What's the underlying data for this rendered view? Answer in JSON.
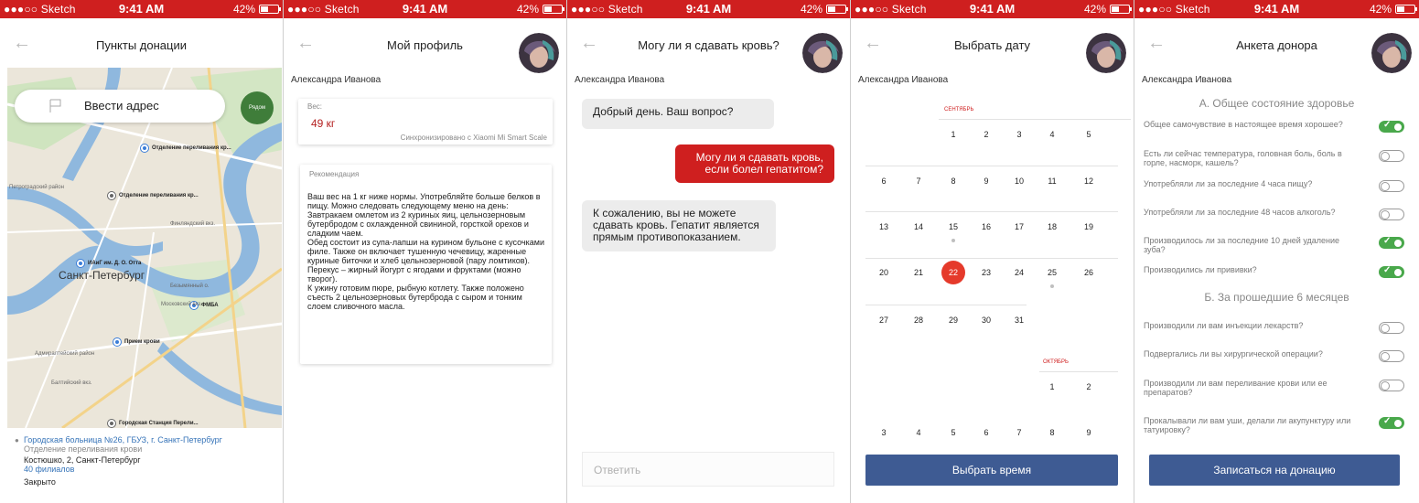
{
  "status": {
    "carrier": "●●●○○ Sketch",
    "time": "9:41 AM",
    "battery": "42%",
    "battery_level": 0.42
  },
  "screen1": {
    "title": "Пункты донации",
    "address_placeholder": "Ввести адрес",
    "near_button": "Рядом",
    "pins": [
      "Отделение переливания кр...",
      "Отделение переливания кр...",
      "ИАиГ им. Д. О. Отта",
      "ФМБА",
      "Прием крови",
      "Городская Станция Перели..."
    ],
    "map_labels": [
      "Петроградский район",
      "Финляндский вкз.",
      "Московский вкз.",
      "Безымянный о.",
      "Адмиралтейский район",
      "Балтийский вкз."
    ],
    "city": "Санкт-Петербург",
    "info": {
      "link": "Городская больница №26, ГБУЗ, г. Санкт-Петербург",
      "sub": "Отделение переливания крови",
      "address": "Костюшко, 2, Санкт-Петербург",
      "branches": "40 филиалов",
      "status": "Закрыто"
    }
  },
  "screen2": {
    "title": "Мой профиль",
    "username": "Александра Иванова",
    "weight_label": "Вес:",
    "weight_value": "49 кг",
    "sync": "Синхронизировано с Xiaomi Mi Smart Scale",
    "rec_label": "Рекомендация",
    "rec_body": "Ваш вес на 1 кг ниже нормы. Употребляйте больше белков в пищу. Можно следовать следующему меню на день:\nЗавтракаем омлетом из 2 куриных яиц, цельнозерновым бутербродом с охлажденной свининой, горсткой орехов и сладким чаем.\nОбед состоит из супа-лапши на курином бульоне с кусочками филе. Также он включает тушенную чечевицу, жаренные куриные биточки и хлеб цельнозерновой (пару ломтиков).\nПерекус – жирный йогурт с ягодами и фруктами (можно творог).\nК ужину готовим пюре, рыбную котлету. Также положено съесть 2 цельнозерновых бутерброда с сыром и тонким слоем сливочного масла."
  },
  "screen3": {
    "title": "Могу ли я сдавать кровь?",
    "username": "Александра Иванова",
    "messages": [
      {
        "side": "in",
        "text": "Добрый день. Ваш вопрос?"
      },
      {
        "side": "out",
        "text": "Могу ли я сдавать кровь, если болел гепатитом?"
      },
      {
        "side": "in",
        "text": "К сожалению, вы не можете сдавать кровь. Гепатит является прямым противопоказанием."
      }
    ],
    "reply_placeholder": "Ответить"
  },
  "screen4": {
    "title": "Выбрать дату",
    "username": "Александра Иванова",
    "month1": "СЕНТЯБРЬ",
    "month2": "ОКТЯБРЬ",
    "days1": [
      "1",
      "2",
      "3",
      "4",
      "5",
      "6",
      "7",
      "8",
      "9",
      "10",
      "11",
      "12",
      "13",
      "14",
      "15",
      "16",
      "17",
      "18",
      "19",
      "20",
      "21",
      "22",
      "23",
      "24",
      "25",
      "26",
      "27",
      "28",
      "29",
      "30",
      "31"
    ],
    "days2": [
      "1",
      "2",
      "3",
      "4",
      "5",
      "6",
      "7",
      "8",
      "9"
    ],
    "selected_day": "22",
    "marked_days": [
      "15",
      "25"
    ],
    "button": "Выбрать время"
  },
  "screen5": {
    "title": "Анкета донора",
    "username": "Александра Иванова",
    "section_a": "А. Общее состояние здоровье",
    "section_b": "Б. За прошедшие 6 месяцев",
    "questions_a": [
      {
        "text": "Общее самочувствие в настоящее время хорошее?",
        "on": true
      },
      {
        "text": "Есть ли сейчас температура, головная боль, боль в горле, насморк, кашель?",
        "on": false
      },
      {
        "text": "Употребляли ли за последние 4 часа пищу?",
        "on": false
      },
      {
        "text": "Употребляли ли за последние 48 часов алкоголь?",
        "on": false
      },
      {
        "text": "Производилось ли за последние 10 дней удаление зуба?",
        "on": true
      },
      {
        "text": "Производились ли прививки?",
        "on": true
      }
    ],
    "questions_b": [
      {
        "text": "Производили ли вам инъекции лекарств?",
        "on": false
      },
      {
        "text": "Подвергались ли вы хирургической операции?",
        "on": false
      },
      {
        "text": "Производили ли вам переливание крови или ее препаратов?",
        "on": false
      },
      {
        "text": "Прокалывали ли вам уши, делали ли акупунктуру или татуировку?",
        "on": true
      }
    ],
    "button": "Записаться на донацию"
  }
}
